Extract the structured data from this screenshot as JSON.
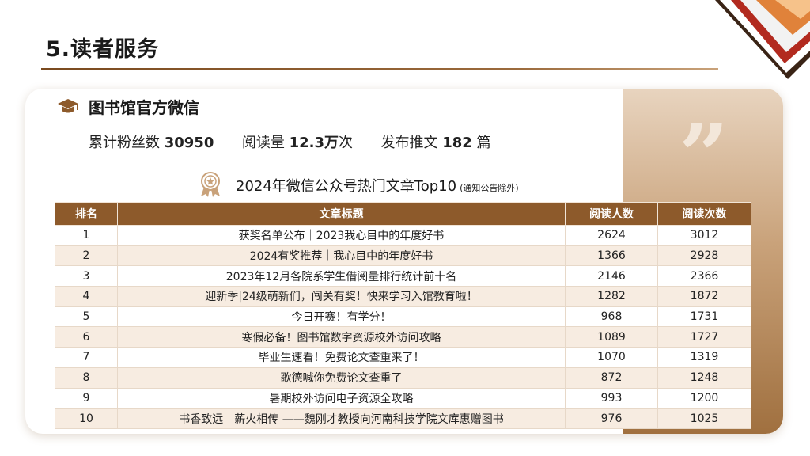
{
  "page": {
    "title": "5.读者服务"
  },
  "section": {
    "title": "图书馆官方微信",
    "stats": {
      "fans_label": "累计粉丝数",
      "fans_value": "30950",
      "reads_label": "阅读量",
      "reads_value": "12.3万",
      "reads_unit": "次",
      "posts_label": "发布推文",
      "posts_value": "182",
      "posts_unit": "篇"
    },
    "quote_mark": "”"
  },
  "table": {
    "caption": "2024年微信公众号热门文章Top10",
    "caption_note": "(通知公告除外)",
    "headers": [
      "排名",
      "文章标题",
      "阅读人数",
      "阅读次数"
    ],
    "rows": [
      [
        "1",
        "获奖名单公布｜2023我心目中的年度好书",
        "2624",
        "3012"
      ],
      [
        "2",
        "2024有奖推荐｜我心目中的年度好书",
        "1366",
        "2928"
      ],
      [
        "3",
        "2023年12月各院系学生借阅量排行统计前十名",
        "2146",
        "2366"
      ],
      [
        "4",
        "迎新季|24级萌新们，闯关有奖！快来学习入馆教育啦！",
        "1282",
        "1872"
      ],
      [
        "5",
        "今日开赛！有学分！",
        "968",
        "1731"
      ],
      [
        "6",
        "寒假必备！图书馆数字资源校外访问攻略",
        "1089",
        "1727"
      ],
      [
        "7",
        "毕业生速看！免费论文查重来了！",
        "1070",
        "1319"
      ],
      [
        "8",
        "歌德喊你免费论文查重了",
        "872",
        "1248"
      ],
      [
        "9",
        "暑期校外访问电子资源全攻略",
        "993",
        "1200"
      ],
      [
        "10",
        "书香致远　薪火相传 ——魏刚才教授向河南科技学院文库惠赠图书",
        "976",
        "1025"
      ]
    ]
  },
  "colors": {
    "accent": "#8d5a2b",
    "row_alt": "#f7ece1"
  },
  "icons": [
    "book-stack-icon",
    "graduation-cap-icon",
    "award-medal-icon",
    "quote-icon"
  ]
}
